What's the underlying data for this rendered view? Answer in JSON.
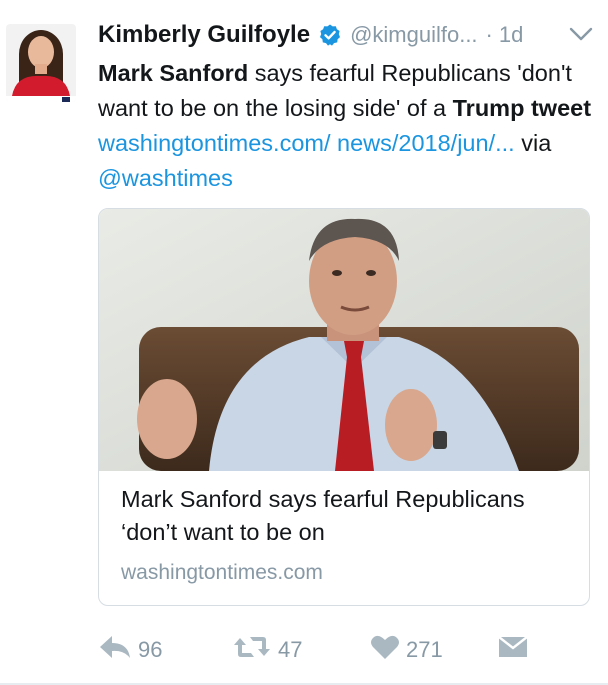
{
  "author": {
    "name": "Kimberly Guilfoyle",
    "handle": "@kimguilfo...",
    "time": "1d",
    "separator": "·",
    "avatar_caption": "Kimberly Guilfoyle"
  },
  "tweet": {
    "part1_bold": "Mark Sanford",
    "part2": " says fearful Republicans 'don't want to be on the losing side' of a ",
    "part3_bold": "Trump tweet",
    "part4_link": " washingtontimes.com/ news/2018/jun/...",
    "part5": " via ",
    "part6_mention": "@washtimes"
  },
  "card": {
    "title": "Mark Sanford says fearful Republicans ‘don’t want to be on",
    "domain": "washingtontimes.com"
  },
  "actions": {
    "reply_count": "96",
    "retweet_count": "47",
    "like_count": "271"
  },
  "colors": {
    "link": "#1b95e0",
    "muted": "#8899a6",
    "text": "#14171a",
    "border": "#d6dde3"
  }
}
